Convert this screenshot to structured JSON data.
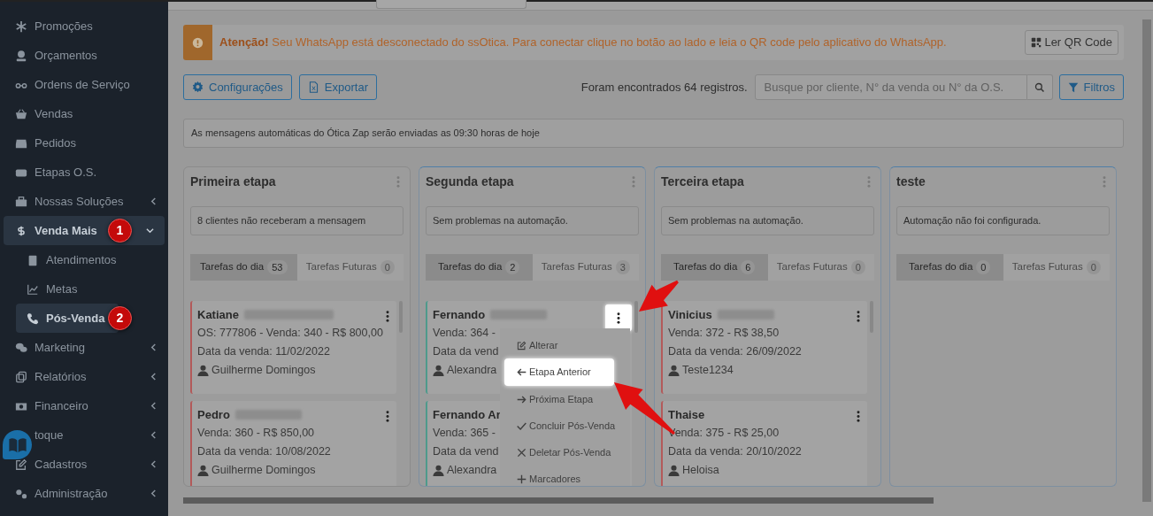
{
  "sidebar": {
    "items": [
      {
        "label": "Promoções",
        "selected": false
      },
      {
        "label": "Orçamentos",
        "selected": false
      },
      {
        "label": "Ordens de Serviço",
        "selected": false
      },
      {
        "label": "Vendas",
        "selected": false
      },
      {
        "label": "Pedidos",
        "selected": false
      },
      {
        "label": "Etapas O.S.",
        "selected": false
      },
      {
        "label": "Nossas Soluções",
        "expanded": false,
        "selected": false
      },
      {
        "label": "Venda Mais",
        "expanded": true,
        "selected": true,
        "step": "1",
        "children": [
          {
            "label": "Atendimentos",
            "selected": false
          },
          {
            "label": "Metas",
            "selected": false
          },
          {
            "label": "Pós-Venda",
            "selected": true,
            "step": "2"
          }
        ]
      },
      {
        "label": "Marketing",
        "expanded": false,
        "selected": false
      },
      {
        "label": "Relatórios",
        "expanded": false,
        "selected": false
      },
      {
        "label": "Financeiro",
        "expanded": false,
        "selected": false
      },
      {
        "label": "toque",
        "expanded": false,
        "selected": false
      },
      {
        "label": "Cadastros",
        "expanded": false,
        "selected": false
      },
      {
        "label": "Administração",
        "expanded": false,
        "selected": false
      }
    ]
  },
  "alert": {
    "message": "**Atenção!** Seu WhatsApp está desconectado do ssOtica. Para conectar clique no botão ao lado e leia o QR code pelo aplicativo do WhatsApp.",
    "button": "Ler QR Code"
  },
  "toolbar": {
    "buttons": [
      "Configurações",
      "Exportar"
    ],
    "result_count": "Foram encontrados 64 registros.",
    "search": {
      "placeholder": "Busque por cliente, N° da venda ou N° da O.S."
    },
    "filter_button": "Filtros"
  },
  "info": "As mensagens automáticas do Ótica Zap serão enviadas as 09:30 horas de hoje",
  "columns": [
    {
      "title": "Primeira etapa",
      "status": "8 clientes não receberam a mensagem",
      "tabs": [
        {
          "label": "Tarefas do dia",
          "count": "53",
          "selected": true
        },
        {
          "label": "Tarefas Futuras",
          "count": "0",
          "selected": false
        }
      ],
      "cards": [
        {
          "name": "Katiane",
          "color": "#b35a5a",
          "menu_open": false,
          "lines": [
            "OS: 777806 - Venda: 340 - R$ 800,00",
            "Data da venda: 11/02/2022"
          ],
          "seller": "Guilherme Domingos"
        },
        {
          "name": "Pedro",
          "color": "#b35a5a",
          "menu_open": false,
          "lines": [
            "Venda: 360 - R$ 850,00",
            "Data da venda: 10/08/2022"
          ],
          "seller": "Guilherme Domingos"
        }
      ]
    },
    {
      "title": "Segunda etapa",
      "status": "Sem problemas na automação.",
      "tabs": [
        {
          "label": "Tarefas do dia",
          "count": "2",
          "selected": true
        },
        {
          "label": "Tarefas Futuras",
          "count": "3",
          "selected": false
        }
      ],
      "cards": [
        {
          "name": "Fernando",
          "color": "#4f9a8c",
          "menu_open": true,
          "lines": [
            "Venda: 364 -",
            "Data da vend"
          ],
          "seller": "Alexandra"
        },
        {
          "name": "Fernando Ar",
          "color": "#4f9a8c",
          "menu_open": false,
          "lines": [
            "Venda: 365 -",
            "Data da vend"
          ],
          "seller": "Alexandra"
        }
      ],
      "context_menu": {
        "items": [
          {
            "label": "Alterar",
            "highlighted": false
          },
          {
            "label": "Etapa Anterior",
            "highlighted": true
          },
          {
            "label": "Próxima Etapa",
            "highlighted": false
          },
          {
            "label": "Concluir Pós-Venda",
            "highlighted": false
          },
          {
            "label": "Deletar Pós-Venda",
            "highlighted": false
          },
          {
            "label": "Marcadores",
            "highlighted": false
          }
        ]
      }
    },
    {
      "title": "Terceira etapa",
      "status": "Sem problemas na automação.",
      "tabs": [
        {
          "label": "Tarefas do dia",
          "count": "6",
          "selected": true
        },
        {
          "label": "Tarefas Futuras",
          "count": "0",
          "selected": false
        }
      ],
      "cards": [
        {
          "name": "Vinicius",
          "color": "#b35a5a",
          "menu_open": false,
          "lines": [
            "Venda: 372 - R$ 38,50",
            "Data da venda: 26/09/2022"
          ],
          "seller": "Teste1234"
        },
        {
          "name": "Thaise",
          "color": "#b35a5a",
          "menu_open": false,
          "lines": [
            "Venda: 375 - R$ 25,00",
            "Data da venda: 20/10/2022"
          ],
          "seller": "Heloisa"
        }
      ]
    },
    {
      "title": "teste",
      "status": "Automação não foi configurada.",
      "tabs": [
        {
          "label": "Tarefas do dia",
          "count": "0",
          "selected": true
        },
        {
          "label": "Tarefas Futuras",
          "count": "0",
          "selected": false
        }
      ]
    }
  ]
}
